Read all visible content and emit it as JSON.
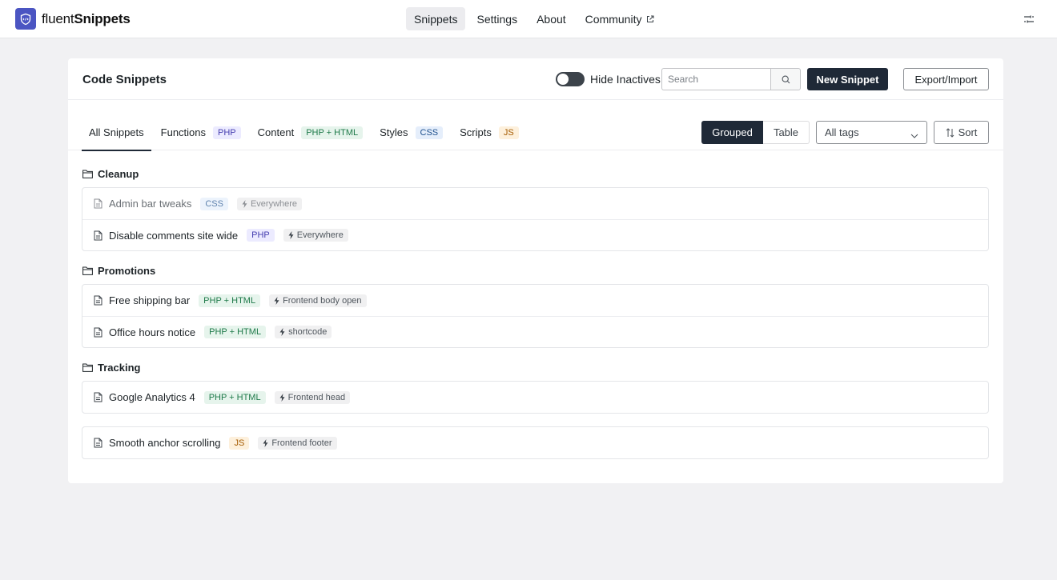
{
  "brand": {
    "name_light": "fluent",
    "name_bold": "Snippets"
  },
  "nav": [
    {
      "label": "Snippets",
      "active": true
    },
    {
      "label": "Settings"
    },
    {
      "label": "About"
    },
    {
      "label": "Community",
      "external": true
    }
  ],
  "header": {
    "title": "Code Snippets",
    "toggle_label": "Hide Inactives",
    "search_placeholder": "Search",
    "new_button": "New Snippet",
    "export_button": "Export/Import"
  },
  "tabs": [
    {
      "label": "All Snippets",
      "badge": ""
    },
    {
      "label": "Functions",
      "badge": "PHP"
    },
    {
      "label": "Content",
      "badge": "PHP + HTML"
    },
    {
      "label": "Styles",
      "badge": "CSS"
    },
    {
      "label": "Scripts",
      "badge": "JS"
    }
  ],
  "view": {
    "grouped": "Grouped",
    "table": "Table",
    "tags_select": "All tags",
    "sort": "Sort"
  },
  "groups": [
    {
      "title": "Cleanup",
      "items": [
        {
          "name": "Admin bar tweaks",
          "lang": "CSS",
          "location": "Everywhere",
          "inactive": true
        },
        {
          "name": "Disable comments site wide",
          "lang": "PHP",
          "location": "Everywhere"
        }
      ]
    },
    {
      "title": "Promotions",
      "items": [
        {
          "name": "Free shipping bar",
          "lang": "PHP + HTML",
          "location": "Frontend body open"
        },
        {
          "name": "Office hours notice",
          "lang": "PHP + HTML",
          "location": "shortcode"
        }
      ]
    },
    {
      "title": "Tracking",
      "items": [
        {
          "name": "Google Analytics 4",
          "lang": "PHP + HTML",
          "location": "Frontend head"
        }
      ]
    }
  ],
  "ungrouped": [
    {
      "name": "Smooth anchor scrolling",
      "lang": "JS",
      "location": "Frontend footer"
    }
  ],
  "colors": {
    "brand": "#4b55c2",
    "primary": "#1f2937",
    "background": "#f1f1f3"
  }
}
